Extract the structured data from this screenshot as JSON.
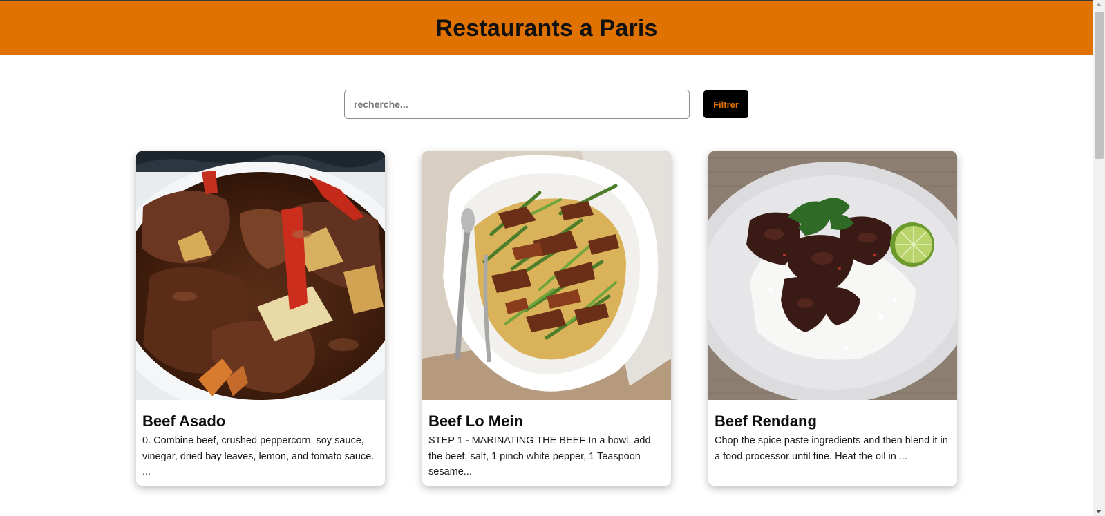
{
  "header": {
    "title": "Restaurants a Paris",
    "background_color": "#e07201"
  },
  "search": {
    "placeholder": "recherche...",
    "value": "",
    "filter_label": "Filtrer"
  },
  "cards": [
    {
      "title": "Beef Asado",
      "description": "0. Combine beef, crushed peppercorn, soy sauce, vinegar, dried bay leaves, lemon, and tomato sauce. ...",
      "image": "beef-asado-photo"
    },
    {
      "title": "Beef Lo Mein",
      "description": "STEP 1 - MARINATING THE BEEF In a bowl, add the beef, salt, 1 pinch white pepper, 1 Teaspoon sesame...",
      "image": "beef-lo-mein-photo"
    },
    {
      "title": "Beef Rendang",
      "description": "Chop the spice paste ingredients and then blend it in a food processor until fine. Heat the oil in ...",
      "image": "beef-rendang-photo"
    }
  ]
}
